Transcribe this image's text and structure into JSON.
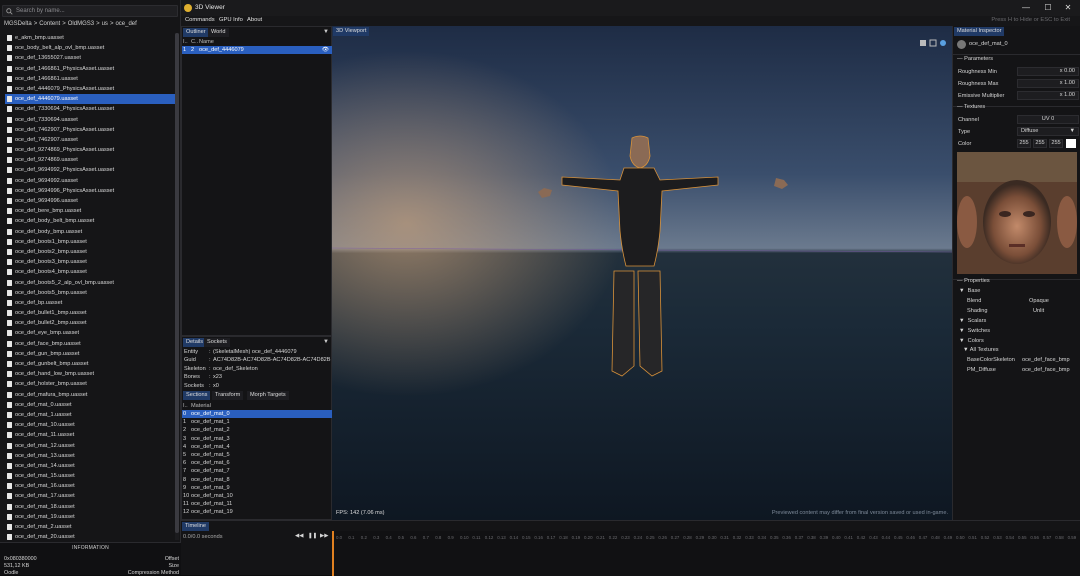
{
  "left": {
    "search_placeholder": "Search by name...",
    "breadcrumb": [
      "MGSDelta",
      ">",
      "Content",
      ">",
      "OldMGS3",
      ">",
      "us",
      ">",
      "oce_def"
    ],
    "files": [
      "e_akm_bmp.uasset",
      "oce_body_belt_alp_ovl_bmp.uasset",
      "oce_def_13655027.uasset",
      "oce_def_1466861_PhysicsAsset.uasset",
      "oce_def_1466861.uasset",
      "oce_def_4446079_PhysicsAsset.uasset",
      "oce_def_4446079.uasset",
      "oce_def_7330694_PhysicsAsset.uasset",
      "oce_def_7330694.uasset",
      "oce_def_7462907_PhysicsAsset.uasset",
      "oce_def_7462907.uasset",
      "oce_def_9274869_PhysicsAsset.uasset",
      "oce_def_9274869.uasset",
      "oce_def_9694992_PhysicsAsset.uasset",
      "oce_def_9694992.uasset",
      "oce_def_9694996_PhysicsAsset.uasset",
      "oce_def_9694996.uasset",
      "oce_def_bere_bmp.uasset",
      "oce_def_body_belt_bmp.uasset",
      "oce_def_body_bmp.uasset",
      "oce_def_boots1_bmp.uasset",
      "oce_def_boots2_bmp.uasset",
      "oce_def_boots3_bmp.uasset",
      "oce_def_boots4_bmp.uasset",
      "oce_def_boots5_2_alp_ovl_bmp.uasset",
      "oce_def_boots5_bmp.uasset",
      "oce_def_bp.uasset",
      "oce_def_bullet1_bmp.uasset",
      "oce_def_bullet2_bmp.uasset",
      "oce_def_eye_bmp.uasset",
      "oce_def_face_bmp.uasset",
      "oce_def_gun_bmp.uasset",
      "oce_def_gunbelt_bmp.uasset",
      "oce_def_hand_low_bmp.uasset",
      "oce_def_holster_bmp.uasset",
      "oce_def_mafura_bmp.uasset",
      "oce_def_mat_0.uasset",
      "oce_def_mat_1.uasset",
      "oce_def_mat_10.uasset",
      "oce_def_mat_11.uasset",
      "oce_def_mat_12.uasset",
      "oce_def_mat_13.uasset",
      "oce_def_mat_14.uasset",
      "oce_def_mat_15.uasset",
      "oce_def_mat_16.uasset",
      "oce_def_mat_17.uasset",
      "oce_def_mat_18.uasset",
      "oce_def_mat_19.uasset",
      "oce_def_mat_2.uasset",
      "oce_def_mat_20.uasset"
    ],
    "selected_index": 6,
    "info": {
      "heading": "INFORMATION",
      "offset_value": "0x080380000",
      "offset_label": "Offset",
      "size_value": "531,12 KB",
      "size_label": "Size",
      "compression_value": "Oodle",
      "compression_label": "Compression Method"
    }
  },
  "window": {
    "title": "3D Viewer",
    "min": "—",
    "max": "☐",
    "close": "✕",
    "menu": [
      "Commands",
      "GPU Info",
      "About"
    ],
    "hint": "Press H to Hide or ESC to Exit"
  },
  "outliner": {
    "tabs": [
      "Outliner",
      "World"
    ],
    "columns": [
      "I..",
      "C..",
      "Name"
    ],
    "rows": [
      {
        "i": "1",
        "c": "2",
        "name": "oce_def_4446079"
      }
    ]
  },
  "details": {
    "tabs": [
      "Details",
      "Sockets"
    ],
    "rows": [
      {
        "k": "Entity",
        "v": "(SkeletalMesh) oce_def_4446079"
      },
      {
        "k": "Guid",
        "v": "AC74D82B-AC74D82B-AC74D82B-AC74D82B"
      },
      {
        "k": "Skeleton",
        "v": "oce_def_Skeleton"
      },
      {
        "k": "Bones",
        "v": "x23"
      },
      {
        "k": "Sockets",
        "v": "x0"
      }
    ],
    "subtabs": [
      "Sections",
      "Transform",
      "Morph Targets"
    ],
    "col_i": "I..",
    "col_material": "Material",
    "materials": [
      {
        "i": "0",
        "name": "oce_def_mat_0"
      },
      {
        "i": "1",
        "name": "oce_def_mat_1"
      },
      {
        "i": "2",
        "name": "oce_def_mat_2"
      },
      {
        "i": "3",
        "name": "oce_def_mat_3"
      },
      {
        "i": "4",
        "name": "oce_def_mat_4"
      },
      {
        "i": "5",
        "name": "oce_def_mat_5"
      },
      {
        "i": "6",
        "name": "oce_def_mat_6"
      },
      {
        "i": "7",
        "name": "oce_def_mat_7"
      },
      {
        "i": "8",
        "name": "oce_def_mat_8"
      },
      {
        "i": "9",
        "name": "oce_def_mat_9"
      },
      {
        "i": "10",
        "name": "oce_def_mat_10"
      },
      {
        "i": "11",
        "name": "oce_def_mat_11"
      },
      {
        "i": "12",
        "name": "oce_def_mat_19"
      }
    ]
  },
  "viewport": {
    "tab": "3D Viewport",
    "fps": "FPS: 142 (7.06 ms)",
    "notice": "Previewed content may differ from final version saved or used in-game."
  },
  "inspector": {
    "tab": "Material Inspector",
    "material_name": "oce_def_mat_0",
    "parameters_heading": "Parameters",
    "params": [
      {
        "k": "Roughness Min",
        "v": "x 0.00"
      },
      {
        "k": "Roughness Max",
        "v": "x 1.00"
      },
      {
        "k": "Emissive Multiplier",
        "v": "x 1.00"
      }
    ],
    "textures_heading": "Textures",
    "channel_label": "Channel",
    "channel_value": "UV 0",
    "type_label": "Type",
    "type_value": "Diffuse",
    "color_label": "Color",
    "color_r": "255",
    "color_g": "255",
    "color_b": "255",
    "properties_heading": "Properties",
    "base_label": "Base",
    "blend_label": "Blend",
    "blend_value": "Opaque",
    "shading_label": "Shading",
    "shading_value": "Unlit",
    "scalars_label": "Scalars",
    "switches_label": "Switches",
    "colors_label": "Colors",
    "all_textures_label": "All Textures",
    "tex_rows": [
      {
        "k": "BaseColorSkeleton",
        "v": "oce_def_face_bmp"
      },
      {
        "k": "PM_Diffuse",
        "v": "oce_def_face_bmp"
      }
    ]
  },
  "timeline": {
    "tab": "Timeline",
    "time": "0.0/0.0 seconds",
    "ticks": [
      "0.0",
      "0.1",
      "0.2",
      "0.3",
      "0.4",
      "0.5",
      "0.6",
      "0.7",
      "0.8",
      "0.9",
      "0.10",
      "0.11",
      "0.12",
      "0.13",
      "0.14",
      "0.15",
      "0.16",
      "0.17",
      "0.18",
      "0.19",
      "0.20",
      "0.21",
      "0.22",
      "0.23",
      "0.24",
      "0.25",
      "0.26",
      "0.27",
      "0.28",
      "0.29",
      "0.30",
      "0.31",
      "0.32",
      "0.33",
      "0.34",
      "0.35",
      "0.36",
      "0.37",
      "0.38",
      "0.39",
      "0.40",
      "0.41",
      "0.42",
      "0.43",
      "0.44",
      "0.45",
      "0.46",
      "0.47",
      "0.48",
      "0.49",
      "0.50",
      "0.51",
      "0.52",
      "0.53",
      "0.54",
      "0.55",
      "0.56",
      "0.57",
      "0.58",
      "0.59"
    ]
  }
}
